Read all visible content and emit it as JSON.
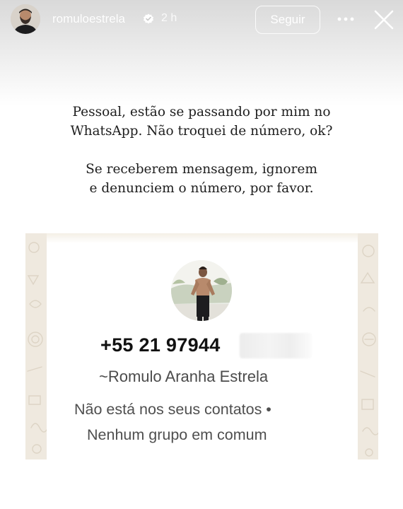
{
  "header": {
    "username": "romuloestrela",
    "time": "2 h",
    "follow_label": "Seguir",
    "verified_icon": "verified-badge-icon",
    "more_icon": "more-dots-icon",
    "close_icon": "close-icon"
  },
  "caption": {
    "paragraph1_line1": "Pessoal, estão se passando por mim no",
    "paragraph1_line2": "WhatsApp. Não troquei de número, ok?",
    "paragraph2_line1": "Se receberem mensagem, ignorem",
    "paragraph2_line2": "e denunciem o número, por favor."
  },
  "whatsapp_screenshot": {
    "phone_number": "+55 21 97944",
    "push_name": "~Romulo Aranha Estrela",
    "info_line1": "Não está nos seus contatos •",
    "info_line2": "Nenhum grupo em comum",
    "background_color": "#efe9df"
  },
  "colors": {
    "header_gradient_top": "#d9d9d9",
    "text_dark": "#1e1e1e",
    "text_gray": "#4f4f4f"
  }
}
